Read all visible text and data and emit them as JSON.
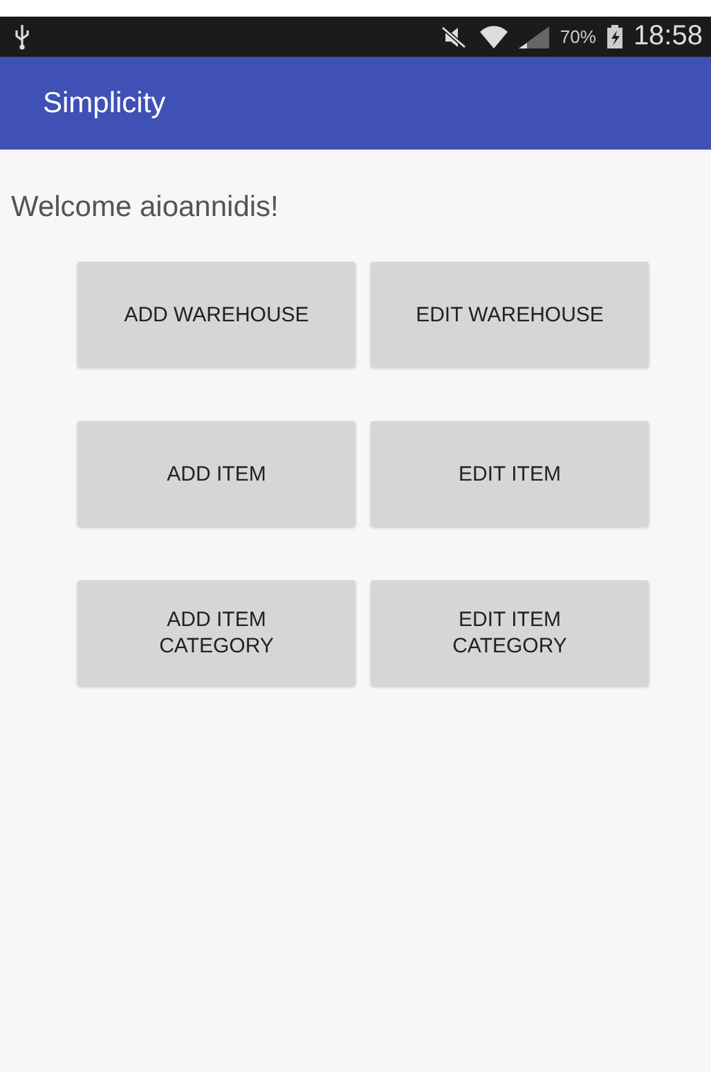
{
  "status_bar": {
    "battery": "70%",
    "time": "18:58"
  },
  "app_bar": {
    "title": "Simplicity"
  },
  "welcome": "Welcome aioannidis!",
  "buttons": [
    {
      "label": "ADD WAREHOUSE"
    },
    {
      "label": "EDIT WAREHOUSE"
    },
    {
      "label": "ADD ITEM"
    },
    {
      "label": "EDIT ITEM"
    },
    {
      "label": "ADD ITEM\nCATEGORY"
    },
    {
      "label": "EDIT ITEM\nCATEGORY"
    }
  ]
}
